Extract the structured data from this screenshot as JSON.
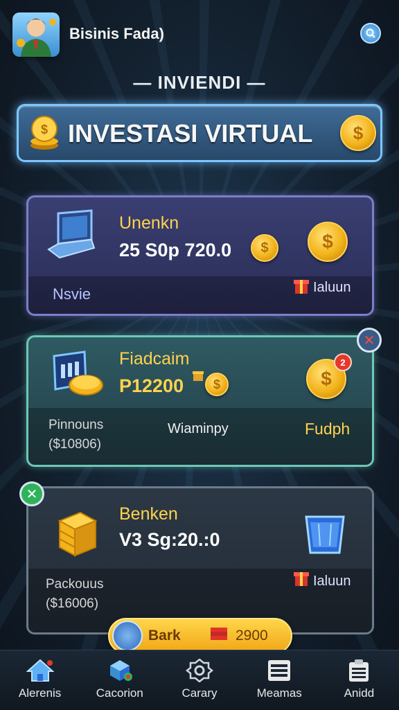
{
  "header": {
    "app_title": "Bisinis Fada)",
    "subtitle": "— INVIENDI —"
  },
  "banner": {
    "title": "INVESTASI VIRTUAL"
  },
  "cards": [
    {
      "name": "Unenkn",
      "amount": "25 S0p 720.0",
      "left_label": "Nsvie",
      "right_label": "Ialuun"
    },
    {
      "name": "Fiadcaim",
      "amount": "P12200",
      "stat_label": "Pinnouns",
      "stat_value": "($10806)",
      "mid_label": "Wiaminpy",
      "right_label": "Fudph",
      "badge": "2"
    },
    {
      "name": "Benken",
      "amount": "V3 Sg:20.:0",
      "stat_label": "Packouus",
      "stat_value": "($16006)",
      "right_label": "Ialuun"
    }
  ],
  "action_pill": {
    "label": "Bark",
    "value": "2900"
  },
  "nav": [
    {
      "label": "Alerenis"
    },
    {
      "label": "Cacorion"
    },
    {
      "label": "Carary"
    },
    {
      "label": "Meamas"
    },
    {
      "label": "Anidd"
    }
  ],
  "colors": {
    "accent_gold": "#ffd34d",
    "banner_border": "#7fc6ff",
    "card1_border": "#7c7fc9",
    "card2_border": "#6fc7b8"
  }
}
